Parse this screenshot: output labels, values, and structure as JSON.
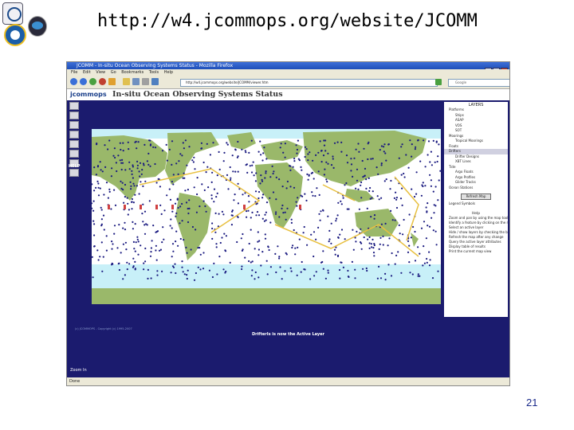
{
  "slide": {
    "title": "http://w4.jcommops.org/website/JCOMM",
    "page_number": "21"
  },
  "browser": {
    "window_title": "JCOMM - In-situ Ocean Observing Systems Status - Mozilla Firefox",
    "menu": [
      "File",
      "Edit",
      "View",
      "Go",
      "Bookmarks",
      "Tools",
      "Help"
    ],
    "address": "http://w4.jcommops.org/website/JCOMM/viewer.htm",
    "search_placeholder": "Google",
    "status_bar": "Done"
  },
  "app": {
    "logo_text": "jcommops",
    "title": "In-situ Ocean Observing Systems Status",
    "help_label": "HELP",
    "status_message": "DrifterIs is now the Active Layer",
    "copyright": "(c) JCOMMOPS - Copyright (c) 1995-2007",
    "zoom_label": "Zoom In",
    "layers_title": "LAYERS",
    "layers": [
      {
        "label": "Platforms",
        "sub": false
      },
      {
        "label": "Ships",
        "sub": true
      },
      {
        "label": "ASAP",
        "sub": true
      },
      {
        "label": "VOS",
        "sub": true
      },
      {
        "label": "SOT",
        "sub": true
      },
      {
        "label": "Moorings",
        "sub": false
      },
      {
        "label": "Tropical Moorings",
        "sub": true
      },
      {
        "label": "Floats",
        "sub": false
      },
      {
        "label": "Drifters",
        "sub": false
      },
      {
        "label": "Drifter Designs",
        "sub": true
      },
      {
        "label": "XBT Lines",
        "sub": true
      },
      {
        "label": "Tide",
        "sub": false
      },
      {
        "label": "Argo Floats",
        "sub": true
      },
      {
        "label": "Argo Profiles",
        "sub": true
      },
      {
        "label": "Glider Tracks",
        "sub": true
      },
      {
        "label": "Ocean Stations",
        "sub": false
      }
    ],
    "refresh_button": "Refresh Map",
    "legend_link": "Legend Symbols",
    "help_title": "Help",
    "help_items": [
      "Zoom and pan by using the map tools",
      "Identify a feature by clicking on the map",
      "Select an active layer",
      "Hide / show layers by checking the boxes",
      "Refresh the map after any change",
      "Query the active layer attributes",
      "Display table of results",
      "Print the current map view"
    ]
  },
  "colors": {
    "browser_frame": "#1b1b6e",
    "ocean": "#ffffff",
    "land": "#9ab86a",
    "ice": "#c8f0f8",
    "dots": "#1a1a80",
    "tracks": "#e8c040",
    "markers": "#d04040"
  }
}
